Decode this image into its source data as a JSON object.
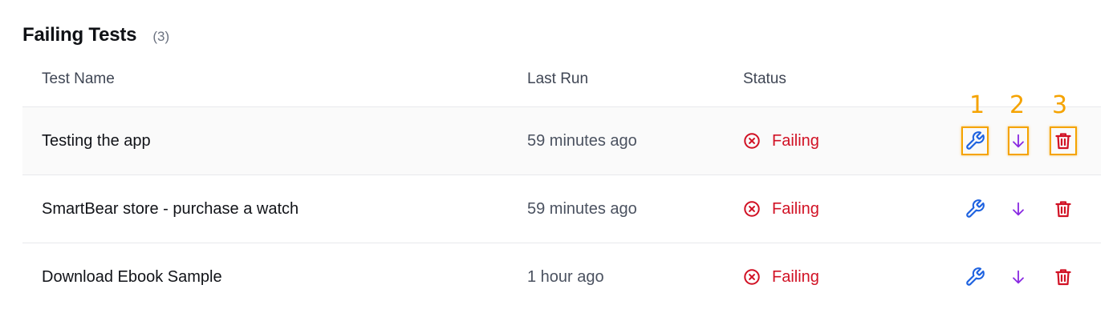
{
  "header": {
    "title": "Failing Tests",
    "count": "(3)"
  },
  "table": {
    "columns": {
      "name": "Test Name",
      "last_run": "Last Run",
      "status": "Status"
    },
    "rows": [
      {
        "name": "Testing the app",
        "last_run": "59 minutes ago",
        "status": "Failing"
      },
      {
        "name": "SmartBear store - purchase a watch",
        "last_run": "59 minutes ago",
        "status": "Failing"
      },
      {
        "name": "Download Ebook Sample",
        "last_run": "1 hour ago",
        "status": "Failing"
      }
    ]
  },
  "annotations": {
    "markers": [
      "1",
      "2",
      "3"
    ]
  },
  "icons": {
    "status": "x-circle-icon",
    "edit": "wrench-icon",
    "download": "arrow-down-icon",
    "delete": "trash-icon"
  },
  "colors": {
    "failing": "#d11124",
    "edit": "#1f63e0",
    "download": "#8a2be2",
    "delete": "#d11124",
    "marker": "#f5a300"
  }
}
